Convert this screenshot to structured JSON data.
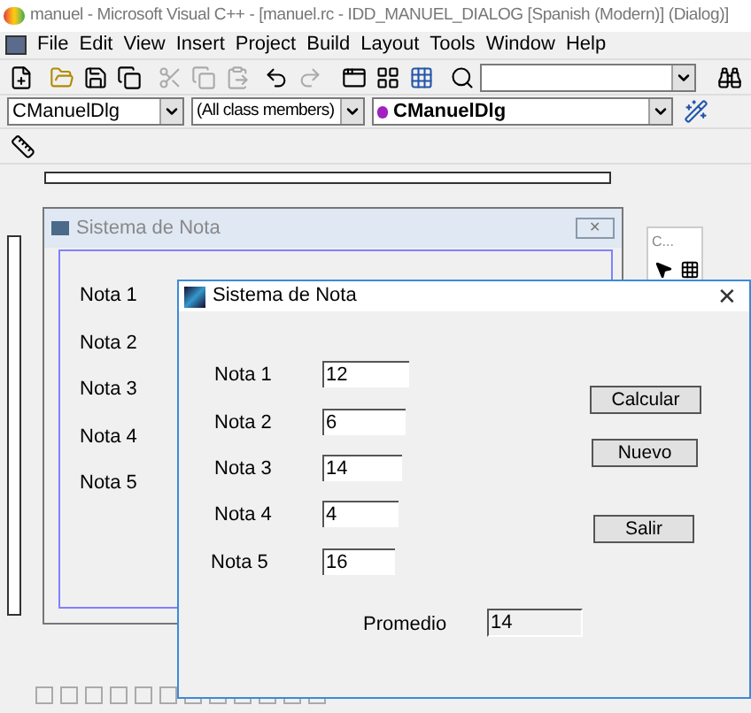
{
  "app_window": {
    "title": "manuel - Microsoft Visual C++ - [manuel.rc - IDD_MANUEL_DIALOG [Spanish (Modern)] (Dialog)]"
  },
  "menu": [
    "File",
    "Edit",
    "View",
    "Insert",
    "Project",
    "Build",
    "Layout",
    "Tools",
    "Window",
    "Help"
  ],
  "wizard_bar": {
    "class": "CManuelDlg",
    "filter": "(All class members)",
    "member": "CManuelDlg"
  },
  "design_dialog": {
    "title": "Sistema de Nota",
    "labels": [
      "Nota 1",
      "Nota 2",
      "Nota 3",
      "Nota 4",
      "Nota 5"
    ],
    "palette_title": "C...",
    "close": "✕"
  },
  "running_dialog": {
    "title": "Sistema de Nota",
    "close": "✕",
    "fields": [
      {
        "label": "Nota 1",
        "value": "12"
      },
      {
        "label": "Nota 2",
        "value": "6"
      },
      {
        "label": "Nota 3",
        "value": "14"
      },
      {
        "label": "Nota 4",
        "value": "4"
      },
      {
        "label": "Nota 5",
        "value": "16"
      }
    ],
    "buttons": [
      "Calcular",
      "Nuevo",
      "Salir"
    ],
    "result": {
      "label": "Promedio",
      "value": "14"
    }
  }
}
